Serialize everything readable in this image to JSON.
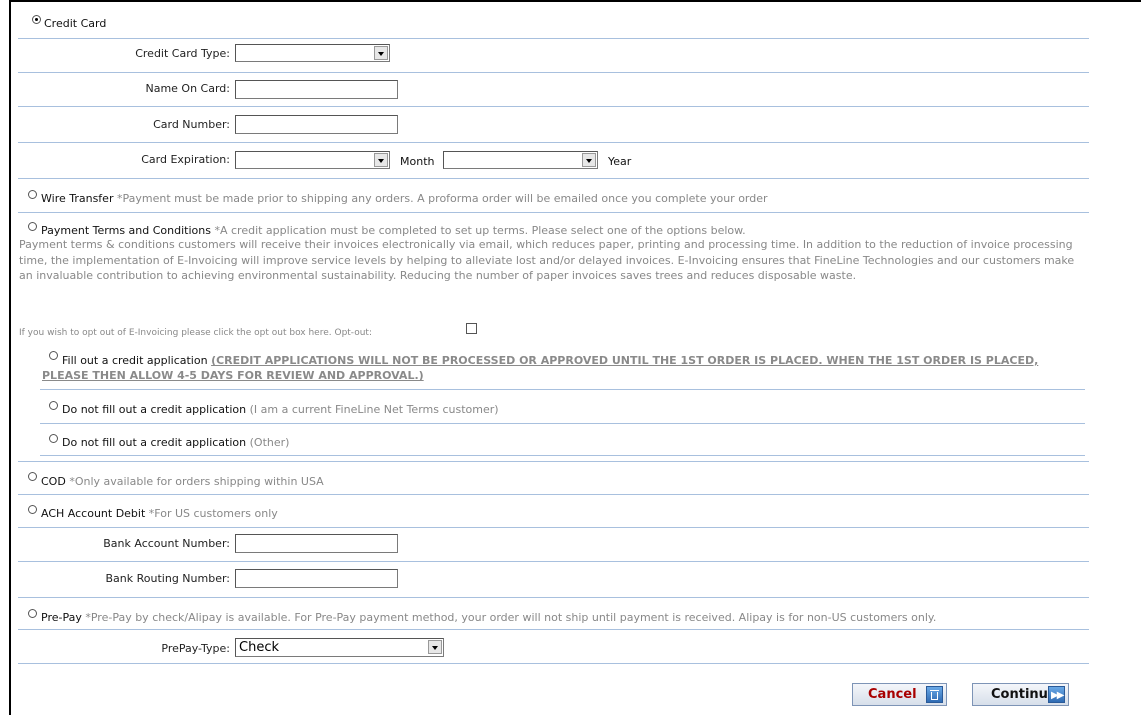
{
  "payment": {
    "credit_card": {
      "label": "Credit Card",
      "type_label": "Credit Card Type:",
      "name_label": "Name On Card:",
      "number_label": "Card Number:",
      "expiration_label": "Card Expiration:",
      "month_label": "Month",
      "year_label": "Year"
    },
    "wire": {
      "label": "Wire Transfer",
      "note": "*Payment must be made prior to shipping any orders. A proforma order will be emailed once you complete your order"
    },
    "terms": {
      "label": "Payment Terms and Conditions",
      "note": "*A credit application must be completed to set up terms. Please select one of the options below.",
      "description": "Payment terms & conditions customers will receive their invoices electronically via email, which reduces paper, printing and processing time. In addition to the reduction of invoice processing time, the implementation of E-Invoicing will improve service levels by helping to alleviate lost and/or delayed invoices. E-Invoicing ensures that FineLine Technologies and our customers make an invaluable contribution to achieving environmental sustainability. Reducing the number of paper invoices saves trees and reduces disposable waste.",
      "optout_text": "If you wish to opt out of E-Invoicing please click the opt out box here. Opt-out:",
      "option1_label": "Fill out a credit application",
      "option1_link": "(CREDIT APPLICATIONS WILL NOT BE PROCESSED OR APPROVED UNTIL THE 1ST ORDER IS PLACED. WHEN THE 1ST ORDER IS PLACED, PLEASE THEN ALLOW 4-5 DAYS FOR REVIEW AND APPROVAL.)",
      "option2_label": "Do not fill out a credit application",
      "option2_note": "(I am a current FineLine Net Terms customer)",
      "option3_label": "Do not fill out a credit application",
      "option3_note": "(Other)"
    },
    "cod": {
      "label": "COD",
      "note": "*Only available for orders shipping within USA"
    },
    "ach": {
      "label": "ACH Account Debit",
      "note": "*For US customers only",
      "account_label": "Bank Account Number:",
      "routing_label": "Bank Routing Number:"
    },
    "prepay": {
      "label": "Pre-Pay",
      "note": "*Pre-Pay by check/Alipay is available. For Pre-Pay payment method, your order will not ship until payment is received. Alipay is for non-US customers only.",
      "type_label": "PrePay-Type:",
      "type_value": "Check"
    }
  },
  "buttons": {
    "cancel": "Cancel",
    "continue": "Continue"
  }
}
